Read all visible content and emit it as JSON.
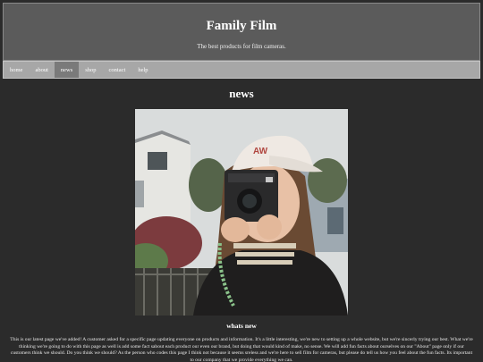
{
  "header": {
    "title": "Family Film",
    "tagline": "The best products for film cameras."
  },
  "nav": {
    "items": [
      {
        "label": "home",
        "active": false
      },
      {
        "label": "about",
        "active": false
      },
      {
        "label": "news",
        "active": true
      },
      {
        "label": "shop",
        "active": false
      },
      {
        "label": "contact",
        "active": false
      },
      {
        "label": "help",
        "active": false
      }
    ]
  },
  "main": {
    "heading": "news",
    "photo_caption_icon": "film-camera-photo",
    "photo_cap_text": "AW",
    "section_heading": "whats new",
    "body": "This is our latest page we've added! A customer asked for a specific page updating everyone on products and information. It's a little interesting, we're new to setting up a whole website, but we're sincerly trying our best. What we're thinking we're going to do with this page as well is add some fact sabout each product our even our brand, but doing that would kind of make, no sense. We will add fun facts about ourselves on our \"About\" page only if our customers think we should. Do you think we should? As the person who codes this page I think not because it seems sreless and we're here to sell film for cameras, but please do tell us how you feel about the fun facts. Its important to our company that we provide everything we can."
  },
  "colors": {
    "page_bg": "#2b2b2b",
    "header_bg": "#5b5b5b",
    "nav_bg": "#a7a7a7",
    "nav_active_bg": "#7a7a7a"
  }
}
